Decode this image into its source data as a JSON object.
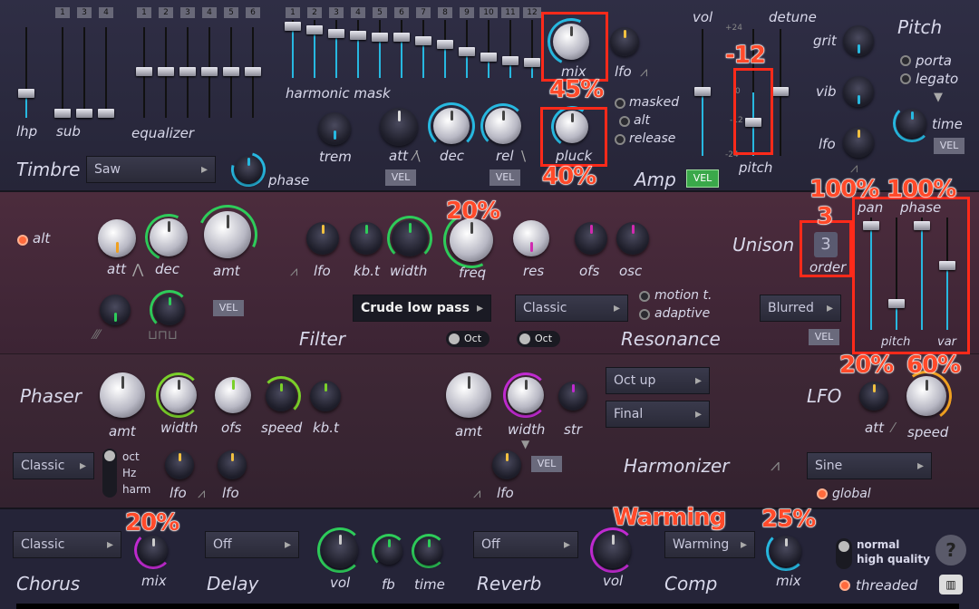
{
  "timbre": {
    "lhp": "lhp",
    "sub": "sub",
    "equalizer": "equalizer",
    "harmonic_mask": "harmonic mask",
    "title": "Timbre",
    "waveform": "Saw",
    "phase": "phase",
    "sub_nums": [
      "1",
      "3",
      "4"
    ],
    "eq_nums": [
      "1",
      "2",
      "3",
      "4",
      "5",
      "6"
    ],
    "mask_nums": [
      "1",
      "2",
      "3",
      "4",
      "5",
      "6",
      "7",
      "8",
      "9",
      "10",
      "11",
      "12"
    ]
  },
  "amp": {
    "mix": "mix",
    "lfo": "lfo",
    "trem": "trem",
    "att": "att",
    "dec": "dec",
    "rel": "rel",
    "pluck": "pluck",
    "vel": "VEL",
    "masked": "masked",
    "alt": "alt",
    "release": "release",
    "title": "Amp",
    "vol": "vol",
    "detune": "detune",
    "pitch": "pitch",
    "scale_top": "+24",
    "scale_mid": "0",
    "scale_m12": "-12",
    "scale_bot": "-24"
  },
  "pitchsec": {
    "grit": "grit",
    "vib": "vib",
    "lfo": "lfo",
    "title": "Pitch",
    "porta": "porta",
    "legato": "legato",
    "time": "time",
    "vel": "VEL"
  },
  "filter": {
    "alt": "alt",
    "att": "att",
    "dec": "dec",
    "amt": "amt",
    "lfo": "lfo",
    "kbt": "kb.t",
    "width": "width",
    "freq": "freq",
    "res": "res",
    "ofs": "ofs",
    "osc": "osc",
    "vel": "VEL",
    "type": "Crude low pass",
    "res_type": "Classic",
    "oct": "Oct",
    "oct2": "Oct",
    "title": "Filter",
    "resonance": "Resonance",
    "motion": "motion t.",
    "adaptive": "adaptive"
  },
  "unison": {
    "title": "Unison",
    "order_value": "3",
    "order": "order",
    "pan": "pan",
    "phase": "phase",
    "pitch": "pitch",
    "var": "var",
    "mode": "Blurred",
    "vel": "VEL"
  },
  "phaser": {
    "title": "Phaser",
    "amt": "amt",
    "width": "width",
    "ofs": "ofs",
    "speed": "speed",
    "kbt": "kb.t",
    "mode": "Classic",
    "oct": "oct",
    "hz": "Hz",
    "harm": "harm",
    "lfo1": "lfo",
    "lfo2": "lfo"
  },
  "harmonizer": {
    "amt": "amt",
    "width": "width",
    "str": "str",
    "oct_up": "Oct up",
    "final": "Final",
    "vel": "VEL",
    "lfo": "lfo",
    "title": "Harmonizer"
  },
  "lfo": {
    "title": "LFO",
    "att": "att",
    "speed": "speed",
    "shape": "Sine",
    "global": "global"
  },
  "fx": {
    "chorus_mode": "Classic",
    "chorus": "Chorus",
    "mix": "mix",
    "delay_mode": "Off",
    "delay": "Delay",
    "vol": "vol",
    "fb": "fb",
    "time": "time",
    "reverb_mode": "Off",
    "reverb": "Reverb",
    "rvol": "vol",
    "comp_mode": "Warming",
    "comp": "Comp",
    "cmix": "mix",
    "normal": "normal",
    "hq": "high quality",
    "threaded": "threaded",
    "help": "?",
    "kbd": "▥"
  },
  "annotations": {
    "mix": "45%",
    "pitch": "-12",
    "pluck": "40%",
    "freq": "20%",
    "order": "3",
    "pan": "100%",
    "phase": "100%",
    "lfo_att": "20%",
    "lfo_speed": "60%",
    "chorus_mix": "20%",
    "comp_mode": "Warming",
    "comp_mix": "25%"
  },
  "colors": {
    "accent": "#27b8e0",
    "annotation": "#ff2a1a",
    "filter_green": "#2ecc5a",
    "magenta": "#d02ab0",
    "orange": "#f0a020"
  }
}
